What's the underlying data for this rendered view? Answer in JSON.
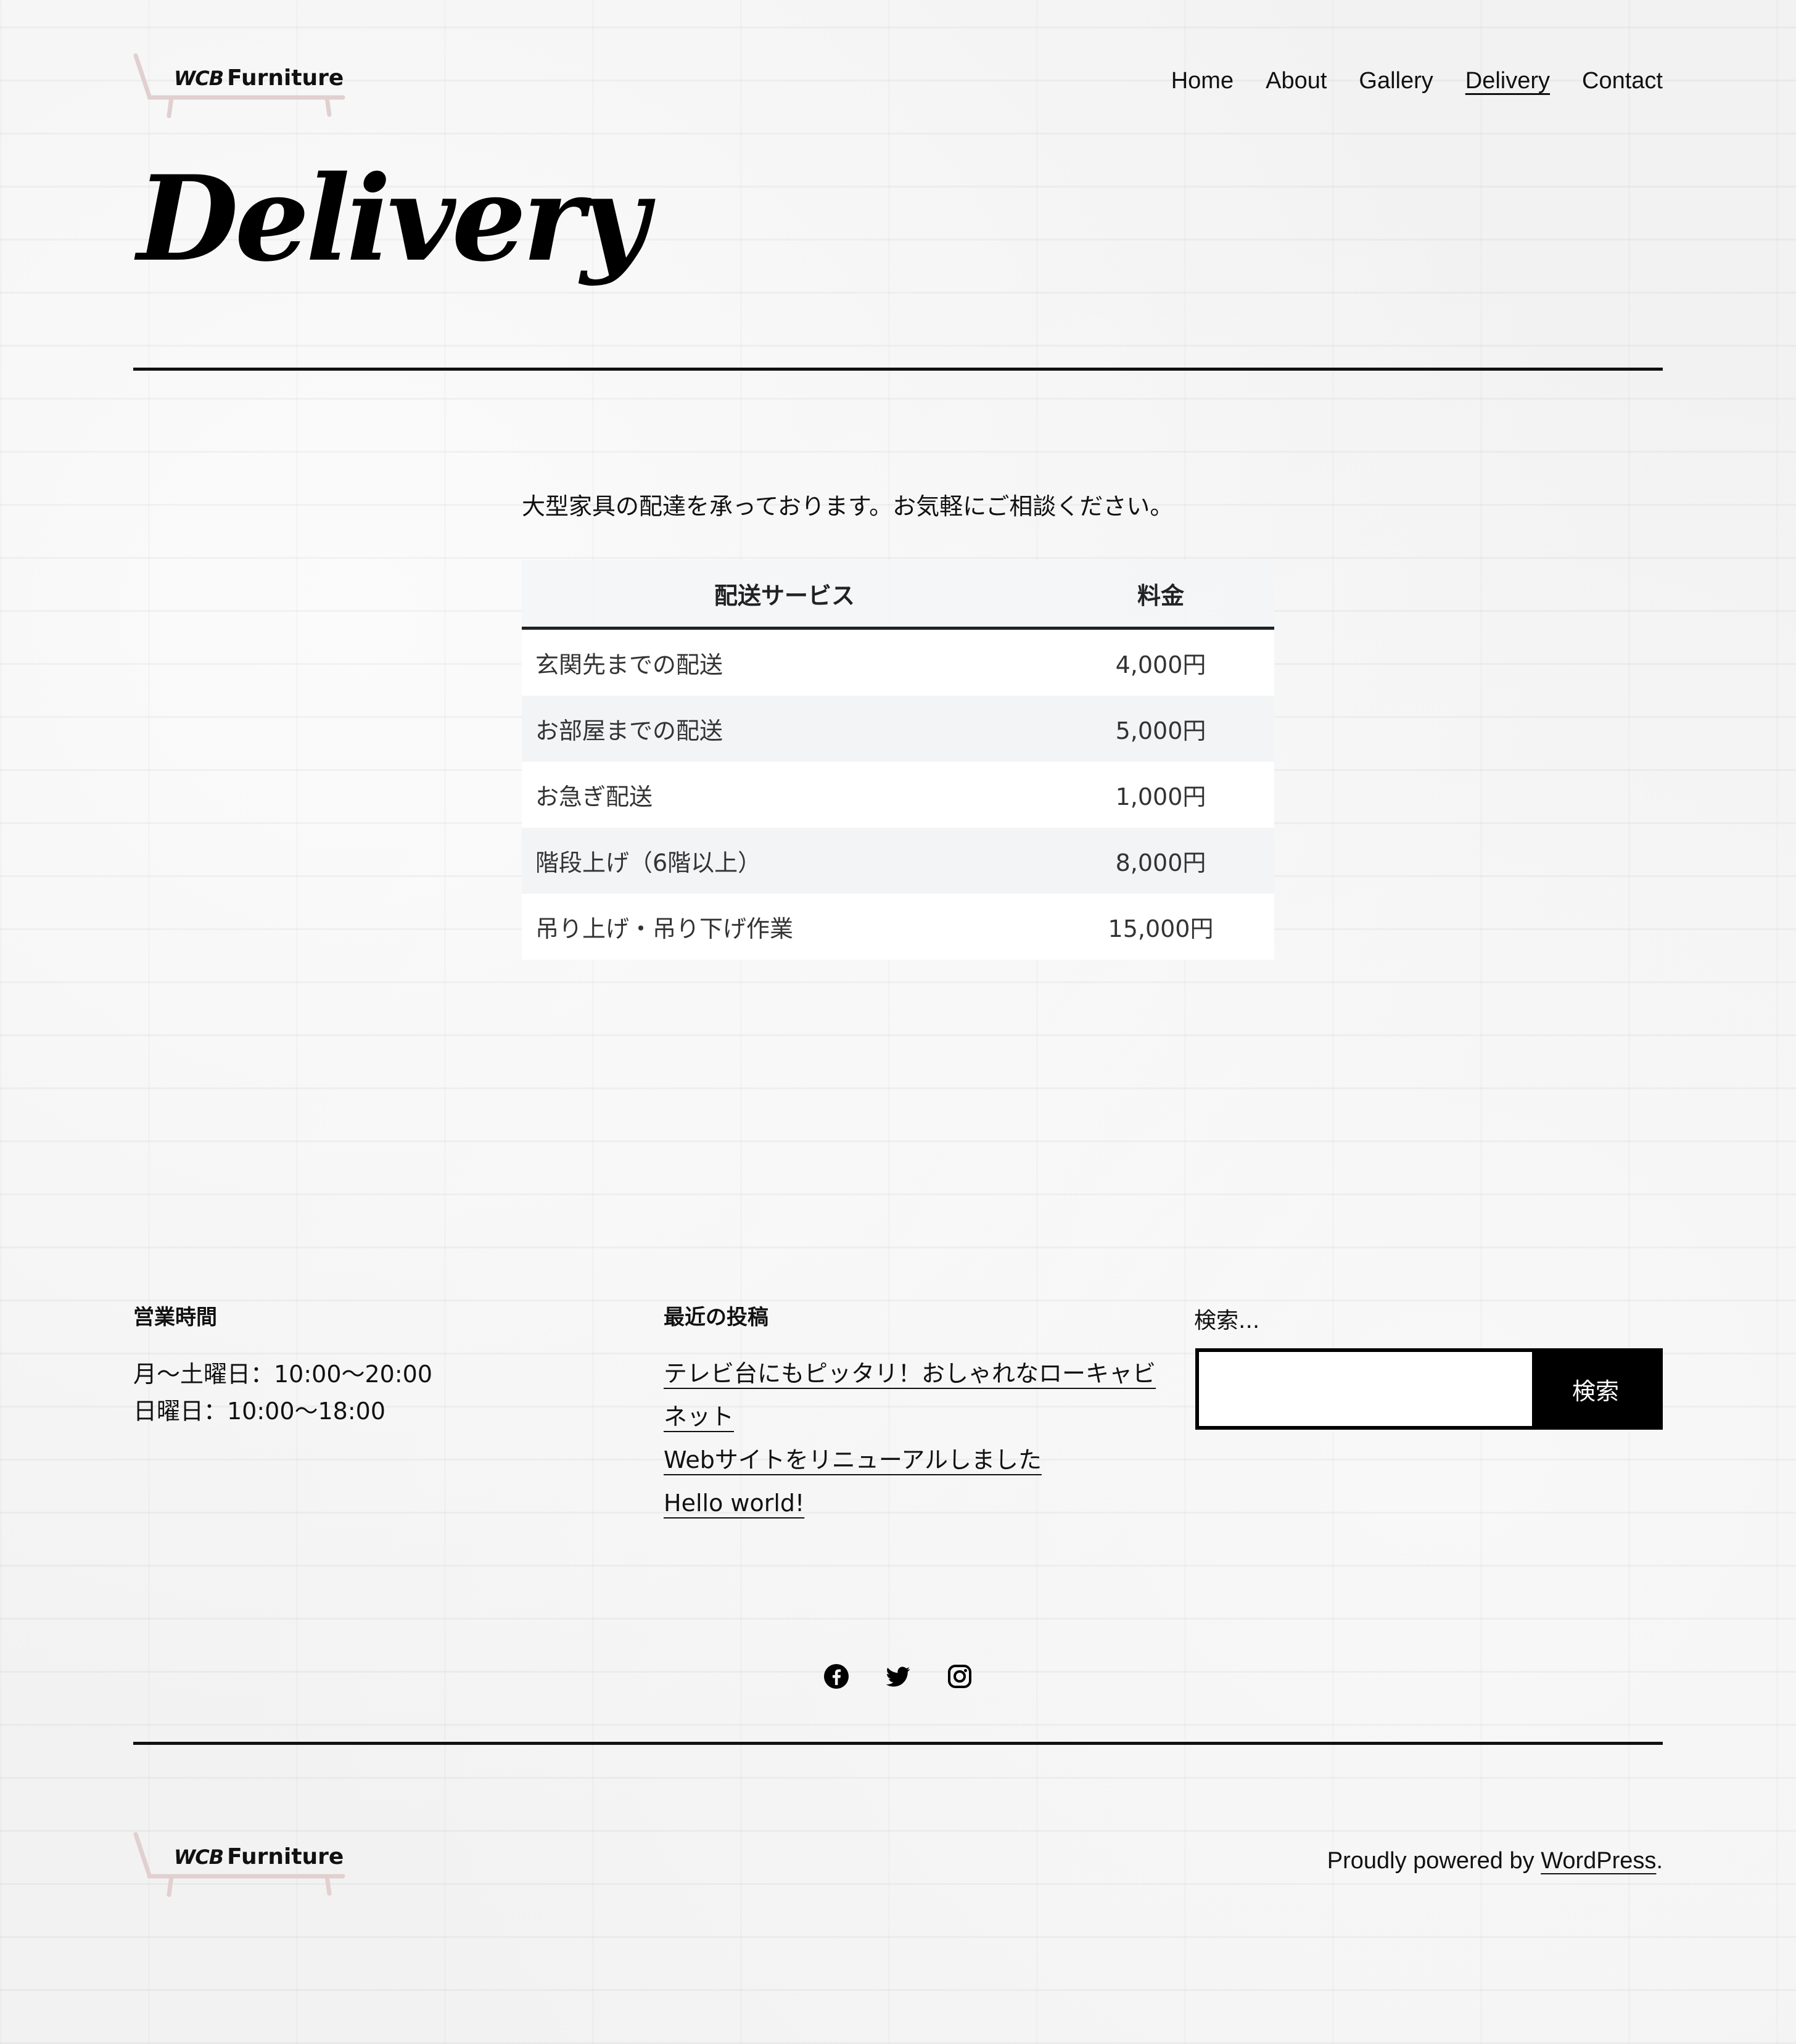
{
  "site": {
    "logo_wcb": "WCB",
    "logo_name": "Furniture",
    "logo_accent": "#e2cfcf"
  },
  "nav": {
    "items": [
      {
        "label": "Home"
      },
      {
        "label": "About"
      },
      {
        "label": "Gallery"
      },
      {
        "label": "Delivery",
        "active": true
      },
      {
        "label": "Contact"
      }
    ]
  },
  "page": {
    "title": "Delivery",
    "intro": "大型家具の配達を承っております。お気軽にご相談ください。"
  },
  "table": {
    "headers": [
      "配送サービス",
      "料金"
    ],
    "rows": [
      [
        "玄関先までの配送",
        "4,000円"
      ],
      [
        "お部屋までの配送",
        "5,000円"
      ],
      [
        "お急ぎ配送",
        "1,000円"
      ],
      [
        "階段上げ（6階以上）",
        "8,000円"
      ],
      [
        "吊り上げ・吊り下げ作業",
        "15,000円"
      ]
    ]
  },
  "footer": {
    "hours_heading": "営業時間",
    "hours_lines": [
      "月〜土曜日：10:00〜20:00",
      "日曜日：10:00〜18:00"
    ],
    "posts_heading": "最近の投稿",
    "posts": [
      "テレビ台にもピッタリ！おしゃれなローキャビネット",
      "Webサイトをリニューアルしました",
      "Hello world!"
    ],
    "search_label": "検索...",
    "search_value": "",
    "search_button": "検索",
    "social_icons": [
      "facebook-icon",
      "twitter-icon",
      "instagram-icon"
    ],
    "powered_prefix": "Proudly powered by ",
    "powered_link": "WordPress",
    "powered_suffix": "."
  }
}
